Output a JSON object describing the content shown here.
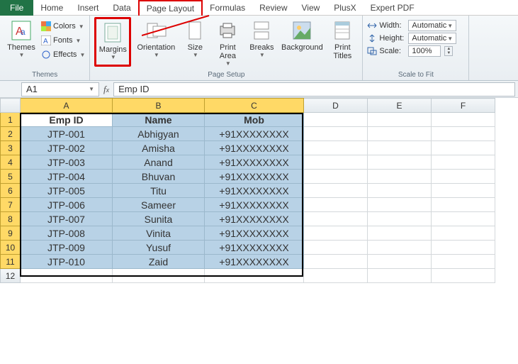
{
  "tabs": {
    "file": "File",
    "home": "Home",
    "insert": "Insert",
    "data": "Data",
    "pagelayout": "Page Layout",
    "formulas": "Formulas",
    "review": "Review",
    "view": "View",
    "plusx": "PlusX",
    "expertpdf": "Expert PDF"
  },
  "ribbon": {
    "themes": {
      "label": "Themes",
      "themes_btn": "Themes",
      "colors": "Colors",
      "fonts": "Fonts",
      "effects": "Effects"
    },
    "pagesetup": {
      "label": "Page Setup",
      "margins": "Margins",
      "orientation": "Orientation",
      "size": "Size",
      "printarea": "Print\nArea",
      "breaks": "Breaks",
      "background": "Background",
      "printtitles": "Print\nTitles"
    },
    "scaletofit": {
      "label": "Scale to Fit",
      "width_lbl": "Width:",
      "width_val": "Automatic",
      "height_lbl": "Height:",
      "height_val": "Automatic",
      "scale_lbl": "Scale:",
      "scale_val": "100%"
    }
  },
  "namebox": "A1",
  "formula": "Emp ID",
  "columns": [
    "A",
    "B",
    "C",
    "D",
    "E",
    "F"
  ],
  "rowcount": 12,
  "table": {
    "headers": [
      "Emp ID",
      "Name",
      "Mob"
    ],
    "rows": [
      [
        "JTP-001",
        "Abhigyan",
        "+91XXXXXXXX"
      ],
      [
        "JTP-002",
        "Amisha",
        "+91XXXXXXXX"
      ],
      [
        "JTP-003",
        "Anand",
        "+91XXXXXXXX"
      ],
      [
        "JTP-004",
        "Bhuvan",
        "+91XXXXXXXX"
      ],
      [
        "JTP-005",
        "Titu",
        "+91XXXXXXXX"
      ],
      [
        "JTP-006",
        "Sameer",
        "+91XXXXXXXX"
      ],
      [
        "JTP-007",
        "Sunita",
        "+91XXXXXXXX"
      ],
      [
        "JTP-008",
        "Vinita",
        "+91XXXXXXXX"
      ],
      [
        "JTP-009",
        "Yusuf",
        "+91XXXXXXXX"
      ],
      [
        "JTP-010",
        "Zaid",
        "+91XXXXXXXX"
      ]
    ]
  }
}
